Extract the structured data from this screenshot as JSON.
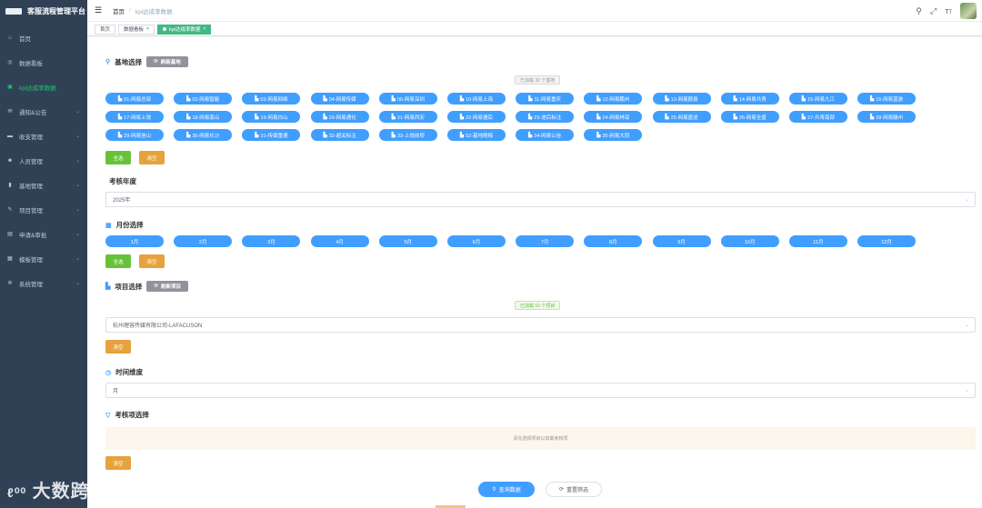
{
  "app": {
    "title": "客服流程管理平台"
  },
  "sidebar": {
    "items": [
      {
        "label": "首页",
        "icon": "home-icon",
        "glyph": "⌂",
        "active": false,
        "arrow": false
      },
      {
        "label": "数据看板",
        "icon": "dashboard-icon",
        "glyph": "◎",
        "active": false,
        "arrow": false
      },
      {
        "label": "kpi达成率数据",
        "icon": "kpi-icon",
        "glyph": "▣",
        "active": true,
        "arrow": false
      },
      {
        "label": "通知&公告",
        "icon": "mail-icon",
        "glyph": "✉",
        "active": false,
        "arrow": true
      },
      {
        "label": "收支管理",
        "icon": "finance-icon",
        "glyph": "▬",
        "active": false,
        "arrow": true
      },
      {
        "label": "人员管理",
        "icon": "user-icon",
        "glyph": "☻",
        "active": false,
        "arrow": true
      },
      {
        "label": "基地管理",
        "icon": "chart-icon",
        "glyph": "▮",
        "active": false,
        "arrow": true
      },
      {
        "label": "项目管理",
        "icon": "edit-icon",
        "glyph": "✎",
        "active": false,
        "arrow": true
      },
      {
        "label": "申请&审批",
        "icon": "document-icon",
        "glyph": "▤",
        "active": false,
        "arrow": true
      },
      {
        "label": "模板管理",
        "icon": "template-icon",
        "glyph": "▦",
        "active": false,
        "arrow": true
      },
      {
        "label": "系统管理",
        "icon": "gear-icon",
        "glyph": "✲",
        "active": false,
        "arrow": true
      }
    ]
  },
  "watermark": "大数跨境",
  "navbar": {
    "crumbs": [
      "首页",
      "kpi达成率数据"
    ]
  },
  "tags": [
    {
      "label": "首页",
      "active": false,
      "closable": false
    },
    {
      "label": "数据看板",
      "active": false,
      "closable": true
    },
    {
      "label": "kpi达成率数据",
      "active": true,
      "closable": true
    }
  ],
  "base_section": {
    "title": "基地选择",
    "refresh_label": "刷新基地",
    "loaded_text": "已加载 32 个基地",
    "bases": [
      "01-网易总部",
      "02-网易智能",
      "03-网易网络",
      "04-网易传媒",
      "00-网易深圳",
      "10-网易上海",
      "11-网易重庆",
      "12-网易鹏州",
      "13-网易郡县",
      "14-网易共青",
      "15-网易九江",
      "16-网易蓝游",
      "17-网易上饶",
      "18-网易南山",
      "19-网易白山",
      "20-网易通化",
      "21-网易西安",
      "22-网易遵后",
      "23-遂后标注",
      "24-网易林琼",
      "25-网易盛途",
      "26-网易全盛",
      "27-共青南部",
      "28-网易滕州",
      "29-网易信山",
      "30-网易长沙",
      "31-传媒重德",
      "32-超关标注",
      "33-上饶前坝",
      "52-基地随梅",
      "34-网易公谷",
      "35-网易大同"
    ],
    "select_all": "全选",
    "clear": "清空"
  },
  "year_section": {
    "label": "考核年度",
    "value": "2025年"
  },
  "month_section": {
    "title": "月份选择",
    "months": [
      "1月",
      "2月",
      "3月",
      "4月",
      "5月",
      "6月",
      "7月",
      "8月",
      "9月",
      "10月",
      "11月",
      "12月"
    ],
    "select_all": "全选",
    "clear": "清空"
  },
  "project_section": {
    "title": "项目选择",
    "refresh_label": "刷新项目",
    "loaded_text": "已加载 10 个项目",
    "value": "杭州理容传媒有限公司-LAFACUSON",
    "clear": "清空"
  },
  "time_section": {
    "title": "时间维度",
    "value": "月"
  },
  "assess_section": {
    "title": "考核项选择",
    "hint": "请先选择项目以加载考核项",
    "clear": "清空"
  },
  "actions": {
    "query": "查询数据",
    "reset": "重置筛选"
  },
  "colors": {
    "sidebar_bg": "#304156",
    "primary": "#409eff",
    "success": "#67c23a",
    "warning": "#e6a23c",
    "active_menu": "#13ce66"
  }
}
